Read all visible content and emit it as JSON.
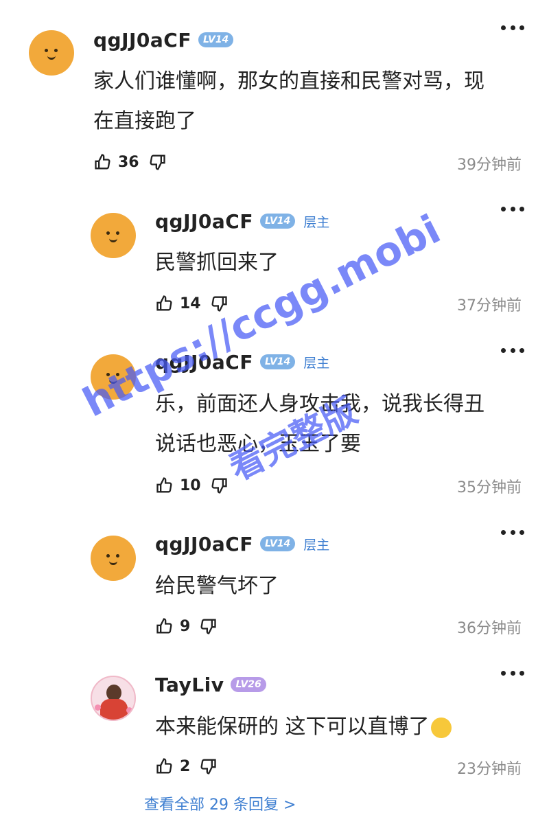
{
  "comments": [
    {
      "username": "qgJJ0aCF",
      "level": "LV14",
      "host_badge": "",
      "lines": [
        "家人们谁懂啊，那女的直接和民警对骂，现",
        "在直接跑了"
      ],
      "likes": "36",
      "time": "39分钟前",
      "avatar": "smiley-avatar"
    },
    {
      "username": "qgJJ0aCF",
      "level": "LV14",
      "host_badge": "层主",
      "lines": [
        "民警抓回来了"
      ],
      "likes": "14",
      "time": "37分钟前",
      "avatar": "smiley-avatar"
    },
    {
      "username": "qgJJ0aCF",
      "level": "LV14",
      "host_badge": "层主",
      "lines": [
        "乐，前面还人身攻击我，说我长得丑",
        "说话也恶心，玉玉了要"
      ],
      "likes": "10",
      "time": "35分钟前",
      "avatar": "smiley-avatar"
    },
    {
      "username": "qgJJ0aCF",
      "level": "LV14",
      "host_badge": "层主",
      "lines": [
        "给民警气坏了"
      ],
      "likes": "9",
      "time": "36分钟前",
      "avatar": "smiley-avatar"
    },
    {
      "username": "TayLiv",
      "level": "LV26",
      "host_badge": "",
      "lines": [
        "本来能保研的 这下可以直博了"
      ],
      "likes": "2",
      "time": "23分钟前",
      "avatar": "photo-avatar",
      "emoji": "rolling-laughing-emoji"
    }
  ],
  "view_all": "查看全部 29 条回复 >",
  "watermark": {
    "line1": "https://ccgg.mobi",
    "line2": "看完整版"
  },
  "colors": {
    "accent": "#3f7fd1",
    "level_blue": "#7fb2e6",
    "level_purple": "#b79be8",
    "avatar_orange": "#f2a93b",
    "time_gray": "#8a8a8a",
    "watermark": "#465af5"
  }
}
